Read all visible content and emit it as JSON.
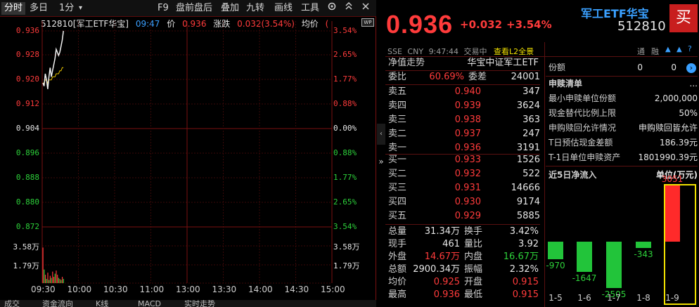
{
  "toolbar": {
    "tabs": [
      "分时",
      "多日",
      "1分"
    ],
    "dropdown_glyph": "▾",
    "actions": [
      "F9",
      "盘前盘后",
      "叠加",
      "九转",
      "画线",
      "工具"
    ]
  },
  "info": {
    "code_name": "512810[军工ETF华宝]",
    "time": "09:47",
    "price_label": "价",
    "price": "0.936",
    "change_label": "涨跌",
    "change": "0.032(3.54%)",
    "avg_label": "均价",
    "avg_partial": "("
  },
  "badge": "WP",
  "price_axis": {
    "left": [
      "0.936",
      "0.928",
      "0.920",
      "0.912",
      "0.904",
      "0.896",
      "0.888",
      "0.880",
      "0.872"
    ],
    "right": [
      "3.54%",
      "2.65%",
      "1.77%",
      "0.88%",
      "0.00%",
      "0.88%",
      "1.77%",
      "2.65%",
      "3.54%"
    ],
    "vol_left": [
      "3.58万",
      "1.79万"
    ],
    "vol_right": [
      "3.58万",
      "1.79万"
    ]
  },
  "time_axis": [
    "09:30",
    "10:00",
    "10:30",
    "11:00",
    "13:00",
    "13:30",
    "14:00",
    "14:30",
    "15:00"
  ],
  "chart_data": {
    "type": "line",
    "x": [
      "09:30",
      "09:31",
      "09:32",
      "09:33",
      "09:34",
      "09:35",
      "09:36",
      "09:37",
      "09:38",
      "09:39",
      "09:40",
      "09:41",
      "09:42",
      "09:43",
      "09:44",
      "09:45",
      "09:46",
      "09:47"
    ],
    "series": [
      {
        "values": [
          0.919,
          0.918,
          0.922,
          0.92,
          0.917,
          0.921,
          0.924,
          0.921,
          0.923,
          0.925,
          0.927,
          0.93,
          0.929,
          0.928,
          0.929,
          0.931,
          0.933,
          0.936
        ]
      },
      {
        "values": [
          0.919,
          0.919,
          0.92,
          0.92,
          0.919,
          0.92,
          0.92,
          0.92,
          0.921,
          0.921,
          0.921,
          0.922,
          0.922,
          0.922,
          0.923,
          0.923,
          0.924,
          0.924
        ]
      }
    ],
    "ylim": [
      0.872,
      0.936
    ],
    "volume": [
      3.4,
      1.3,
      0.8,
      0.4,
      1.0,
      0.3,
      0.7,
      0.5,
      1.1,
      0.6,
      0.9,
      1.2,
      0.8,
      0.5,
      0.4,
      0.3,
      0.6,
      0.4
    ],
    "volume_colors": [
      "red",
      "green",
      "red",
      "green",
      "red",
      "green",
      "red",
      "green",
      "red",
      "red",
      "green",
      "red",
      "red",
      "green",
      "red",
      "green",
      "red",
      "green"
    ],
    "volume_max": 5.37
  },
  "bottom_tabs": [
    "成交",
    "资金流向",
    "K线",
    "MACD",
    "实时走势"
  ],
  "quote": {
    "name": "军工ETF华宝",
    "code": "512810",
    "buy_button": "买",
    "price": "0.936",
    "change": "+0.032",
    "change_pct": "+3.54%",
    "market": "SSE",
    "currency": "CNY",
    "clock": "9:47:44",
    "status": "交易中",
    "l2_link": "查看L2全景",
    "right_icons": [
      "通",
      "融"
    ]
  },
  "nav": {
    "label": "净值走势",
    "index_name": "华宝中证军工ETF"
  },
  "ratio": {
    "label1": "委比",
    "value1": "60.69%",
    "label2": "委差",
    "value2": "24001"
  },
  "asks": [
    {
      "label": "卖五",
      "price": "0.940",
      "vol": "347"
    },
    {
      "label": "卖四",
      "price": "0.939",
      "vol": "3624"
    },
    {
      "label": "卖三",
      "price": "0.938",
      "vol": "363"
    },
    {
      "label": "卖二",
      "price": "0.937",
      "vol": "247"
    },
    {
      "label": "卖一",
      "price": "0.936",
      "vol": "3191"
    }
  ],
  "bids": [
    {
      "label": "买一",
      "price": "0.933",
      "vol": "1526"
    },
    {
      "label": "买二",
      "price": "0.932",
      "vol": "522"
    },
    {
      "label": "买三",
      "price": "0.931",
      "vol": "14666"
    },
    {
      "label": "买四",
      "price": "0.930",
      "vol": "9174"
    },
    {
      "label": "买五",
      "price": "0.929",
      "vol": "5885"
    }
  ],
  "stats": [
    {
      "l1": "总量",
      "v1": "31.34万",
      "c1": "white",
      "l2": "换手",
      "v2": "3.42%",
      "c2": "white"
    },
    {
      "l1": "现手",
      "v1": "461",
      "c1": "white",
      "l2": "量比",
      "v2": "3.92",
      "c2": "white"
    },
    {
      "l1": "外盘",
      "v1": "14.67万",
      "c1": "red",
      "l2": "内盘",
      "v2": "16.67万",
      "c2": "green"
    },
    {
      "l1": "总额",
      "v1": "2900.34万",
      "c1": "white",
      "l2": "振幅",
      "v2": "2.32%",
      "c2": "white"
    },
    {
      "l1": "均价",
      "v1": "0.925",
      "c1": "red",
      "l2": "开盘",
      "v2": "0.915",
      "c2": "red"
    },
    {
      "l1": "最高",
      "v1": "0.936",
      "c1": "red",
      "l2": "最低",
      "v2": "0.915",
      "c2": "red"
    }
  ],
  "shares": {
    "label": "份额",
    "v1": "0",
    "v2": "0"
  },
  "subscription": {
    "title": "申赎清单",
    "more": "...",
    "rows": [
      {
        "l": "最小申赎单位份额",
        "v": "2,000,000"
      },
      {
        "l": "现金替代比例上限",
        "v": "50%"
      },
      {
        "l": "申购赎回允许情况",
        "v": "申购赎回皆允许"
      },
      {
        "l": "T日预估现金差额",
        "v": "186.39元"
      },
      {
        "l": "T-1日单位申赎资产",
        "v": "1801990.39元"
      }
    ]
  },
  "net_inflow": {
    "title": "近5日净流入",
    "unit": "单位(万元)",
    "chart_data": {
      "type": "bar",
      "categories": [
        "1-5",
        "1-6",
        "1-7",
        "1-8",
        "1-9"
      ],
      "values": [
        -970,
        -1647,
        -2505,
        -343,
        3051
      ]
    }
  }
}
